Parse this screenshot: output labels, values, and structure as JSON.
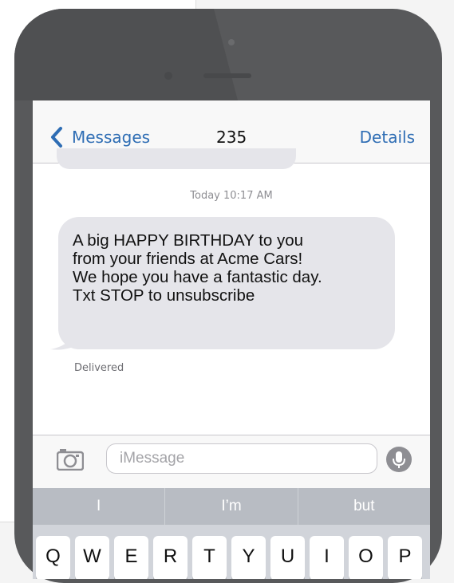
{
  "navbar": {
    "back_label": "Messages",
    "title": "235",
    "details_label": "Details"
  },
  "conversation": {
    "timestamp": "Today  10:17 AM",
    "message_lines": [
      "A big HAPPY BIRTHDAY to you",
      "from your friends at Acme Cars!",
      "We hope you have a fantastic day.",
      "Txt STOP to unsubscribe"
    ],
    "status": "Delivered"
  },
  "composer": {
    "placeholder": "iMessage"
  },
  "suggestions": [
    "I",
    "I’m",
    "but"
  ],
  "keyboard": {
    "row1": [
      "Q",
      "W",
      "E",
      "R",
      "T",
      "Y",
      "U",
      "I",
      "O",
      "P"
    ]
  },
  "colors": {
    "accent": "#2e6db4",
    "bubble": "#e5e5ea",
    "phone_body": "#58595b",
    "suggestion_bar": "#b8bcc3"
  }
}
